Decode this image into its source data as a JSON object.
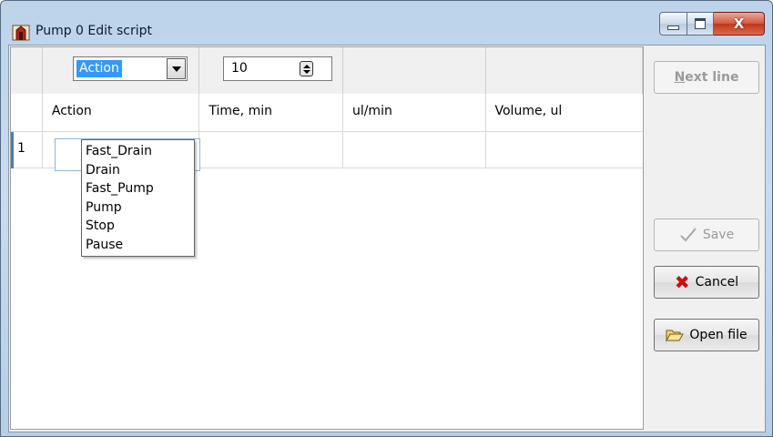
{
  "window": {
    "title": "Pump 0  Edit script",
    "app_icon": "pump-icon"
  },
  "editor_row": {
    "combo_value": "Action",
    "spin_value": "10"
  },
  "grid": {
    "columns": [
      "",
      "Action",
      "Time, min",
      "ul/min",
      "Volume, ul"
    ],
    "rows": [
      {
        "num": "1",
        "action": "",
        "time": "",
        "ul_min": "",
        "volume": ""
      }
    ]
  },
  "dropdown": {
    "items": [
      "Fast_Drain",
      "Drain",
      "Fast_Pump",
      "Pump",
      "Stop",
      "Pause"
    ]
  },
  "buttons": {
    "next_line": "Next line",
    "next_line_access_key": "N",
    "next_line_rest": "ext line",
    "save": "Save",
    "cancel": "Cancel",
    "open_file": "Open file"
  },
  "icons": {
    "save": "checkmark-icon",
    "cancel": "red-x-icon",
    "open_file": "folder-open-icon"
  }
}
